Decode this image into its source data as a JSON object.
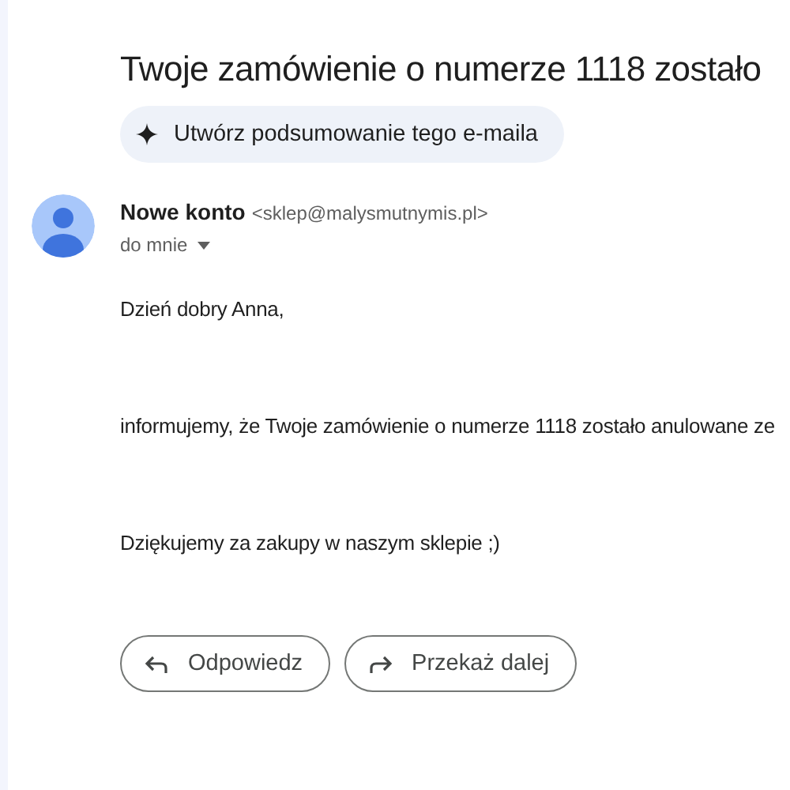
{
  "subject": "Twoje zamówienie o numerze 1118 zostało",
  "summary_chip": {
    "label": "Utwórz podsumowanie tego e-maila"
  },
  "sender": {
    "name": "Nowe konto",
    "address": "<sklep@malysmutnymis.pl>",
    "recipient": "do mnie"
  },
  "body": [
    "Dzień dobry Anna,",
    "informujemy, że Twoje zamówienie o numerze 1118 zostało anulowane ze",
    "Dziękujemy za zakupy w naszym sklepie ;)"
  ],
  "actions": [
    {
      "kind": "reply",
      "label": "Odpowiedz"
    },
    {
      "kind": "forward",
      "label": "Przekaż dalej"
    }
  ]
}
